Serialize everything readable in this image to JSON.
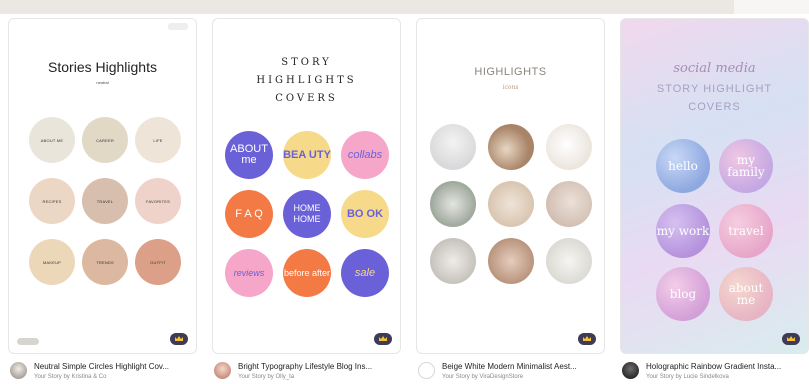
{
  "cards": [
    {
      "title": "Stories Highlights",
      "subtitle": "neutral",
      "circles": [
        {
          "label": "ABOUT ME",
          "color": "#eae5da"
        },
        {
          "label": "CAREER",
          "color": "#e1d9c5"
        },
        {
          "label": "LIFE",
          "color": "#eee4d8"
        },
        {
          "label": "RECIPES",
          "color": "#ecd7c4"
        },
        {
          "label": "TRAVEL",
          "color": "#d8bfad"
        },
        {
          "label": "FAVORITES",
          "color": "#efd3ca"
        },
        {
          "label": "MAKEUP",
          "color": "#ecd7b9"
        },
        {
          "label": "TRENDS",
          "color": "#dbb89f"
        },
        {
          "label": "OUTFIT",
          "color": "#dc9f88"
        }
      ],
      "footer_title": "Neutral Simple Circles Highlight Cov...",
      "footer_author": "Your Story by Kristina & Co"
    },
    {
      "title_lines": [
        "STORY",
        "HIGHLIGHTS",
        "COVERS"
      ],
      "circles": [
        {
          "label": "ABOUT me",
          "color": "#6a61d8",
          "text_color": "#ffffff"
        },
        {
          "label": "BEA UTY",
          "color": "#f7d98a",
          "text_color": "#6a61d8"
        },
        {
          "label": "collabs",
          "color": "#f5a6c9",
          "text_color": "#6a61d8"
        },
        {
          "label": "F A Q",
          "color": "#f47a45",
          "text_color": "#ffffff"
        },
        {
          "label": "HOME HOME",
          "color": "#6a61d8",
          "text_color": "#ffffff"
        },
        {
          "label": "BO OK",
          "color": "#f7d98a",
          "text_color": "#6a61d8"
        },
        {
          "label": "reviews",
          "color": "#f5a6c9",
          "text_color": "#6a61d8"
        },
        {
          "label": "before after",
          "color": "#f47a45",
          "text_color": "#ffffff"
        },
        {
          "label": "sale",
          "color": "#6a61d8",
          "text_color": "#f7d98a"
        }
      ],
      "footer_title": "Bright Typography Lifestyle Blog Ins...",
      "footer_author": "Your Story by Olly_ta"
    },
    {
      "title": "HIGHLIGHTS",
      "subtitle": "icons",
      "circles": [
        {
          "icon": "flower-vase-icon",
          "color": "#d9d9db"
        },
        {
          "icon": "vases-icon",
          "color": "#a98468"
        },
        {
          "icon": "coffee-cup-icon",
          "color": "#ece6df"
        },
        {
          "icon": "plant-icon",
          "color": "#9ea79b"
        },
        {
          "icon": "ceramic-bowl-icon",
          "color": "#d9c5b0"
        },
        {
          "icon": "clock-icon",
          "color": "#d2bfb3"
        },
        {
          "icon": "books-icon",
          "color": "#c5c3bb"
        },
        {
          "icon": "hand-flower-icon",
          "color": "#b9947d"
        },
        {
          "icon": "white-flowers-icon",
          "color": "#dcdad4"
        }
      ],
      "footer_title": "Beige White Modern Minimalist Aest...",
      "footer_author": "Your Story by ViraDesignStore"
    },
    {
      "script_title": "social media",
      "cap_lines": [
        "STORY HIGHLIGHT",
        "COVERS"
      ],
      "circles": [
        {
          "label": "hello",
          "color": "#8ea8e0"
        },
        {
          "label": "my family",
          "color": "#c4a8e3"
        },
        {
          "label": "my work",
          "color": "#b592dd"
        },
        {
          "label": "travel",
          "color": "#e7a6c9"
        },
        {
          "label": "blog",
          "color": "#d39fd8"
        },
        {
          "label": "about me",
          "color": "#e7b4c4"
        }
      ],
      "footer_title": "Holographic Rainbow Gradient Insta...",
      "footer_author": "Your Story by Lucie Sindelkova"
    }
  ]
}
